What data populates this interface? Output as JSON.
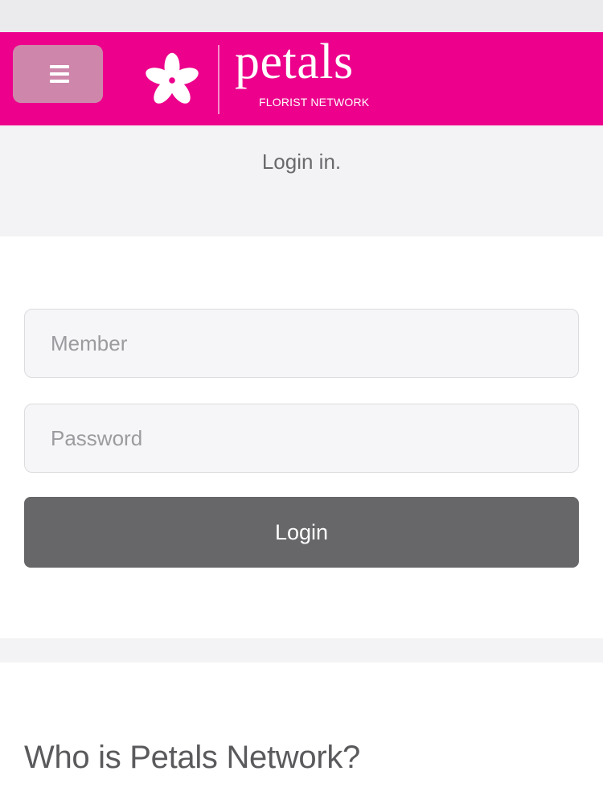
{
  "header": {
    "menu_icon": "hamburger-menu-icon",
    "brand_color": "#ec008c",
    "logo": {
      "wordmark": "petals",
      "tagline": "FLORIST NETWORK",
      "flower_icon": "flower-icon"
    }
  },
  "login": {
    "title": "Login in.",
    "member_placeholder": "Member",
    "password_placeholder": "Password",
    "button_label": "Login",
    "button_color": "#676669"
  },
  "about": {
    "heading": "Who is Petals Network?"
  }
}
